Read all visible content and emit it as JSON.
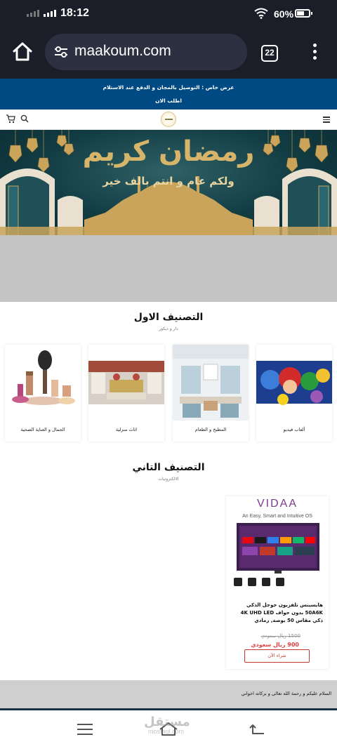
{
  "status": {
    "time": "18:12",
    "battery": "60%"
  },
  "browser": {
    "url": "maakoum.com",
    "tab_count": "22"
  },
  "promo": {
    "line1": "عرض خاص : التوصيل بالمجان و الدفع عند الاستلام",
    "line2": "اطلب الان"
  },
  "banner": {
    "title": "رمضان كريم",
    "subtitle": "ولكم عام و انتم بالف خير"
  },
  "section1": {
    "title": "التصنيف الاول",
    "subtitle": "دار و ديكور",
    "categories": [
      {
        "name": "ألعاب فيديو"
      },
      {
        "name": "المطبخ و الطعام"
      },
      {
        "name": "اثاث منزلية"
      },
      {
        "name": "الجمال و العناية الصحية"
      }
    ]
  },
  "section2": {
    "title": "التصنيف التاني",
    "subtitle": "الالكترونيات"
  },
  "product": {
    "brand": "VIDAA",
    "tagline": "An Easy, Smart and Intuitive OS",
    "name": "هايسينس تلفزيون جوجل الذكي 50A6K بدون حواف 4K UHD LED ذكي مقاس 50 بوصة, رمادي",
    "old_price": "1500 ريال سعودي",
    "new_price": "900 ريال سعودي",
    "buy_label": "شراء الآن"
  },
  "footer": {
    "text": "السلام عليكم و رحمة الله تعالى و بركاته اخواني"
  },
  "watermark": {
    "text": "مستقل",
    "sub": "mostaql.com"
  }
}
